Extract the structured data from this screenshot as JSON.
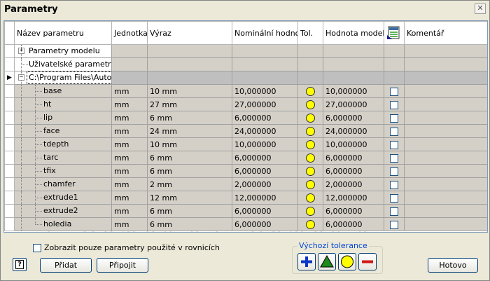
{
  "window": {
    "title": "Parametry",
    "close_label": "✕"
  },
  "columns": {
    "name": "Název parametru",
    "unit": "Jednotka",
    "expr": "Výraz",
    "nominal": "Nominální hodnota",
    "tol": "Tol.",
    "model": "Hodnota modelu",
    "export_icon": "export-parameters-icon",
    "comment": "Komentář"
  },
  "groups": {
    "model_params": "Parametry modelu",
    "user_params": "Uživatelské parametry",
    "path": "C:\\Program Files\\Auto..."
  },
  "params": [
    {
      "name": "base",
      "unit": "mm",
      "expr": "10 mm",
      "nominal": "10,000000",
      "model": "10,000000"
    },
    {
      "name": "ht",
      "unit": "mm",
      "expr": "27 mm",
      "nominal": "27,000000",
      "model": "27,000000"
    },
    {
      "name": "lip",
      "unit": "mm",
      "expr": "6 mm",
      "nominal": "6,000000",
      "model": "6,000000"
    },
    {
      "name": "face",
      "unit": "mm",
      "expr": "24 mm",
      "nominal": "24,000000",
      "model": "24,000000"
    },
    {
      "name": "tdepth",
      "unit": "mm",
      "expr": "10 mm",
      "nominal": "10,000000",
      "model": "10,000000"
    },
    {
      "name": "tarc",
      "unit": "mm",
      "expr": "6 mm",
      "nominal": "6,000000",
      "model": "6,000000"
    },
    {
      "name": "tfix",
      "unit": "mm",
      "expr": "6 mm",
      "nominal": "6,000000",
      "model": "6,000000"
    },
    {
      "name": "chamfer",
      "unit": "mm",
      "expr": "2 mm",
      "nominal": "2,000000",
      "model": "2,000000"
    },
    {
      "name": "extrude1",
      "unit": "mm",
      "expr": "12 mm",
      "nominal": "12,000000",
      "model": "12,000000"
    },
    {
      "name": "extrude2",
      "unit": "mm",
      "expr": "6 mm",
      "nominal": "6,000000",
      "model": "6,000000"
    },
    {
      "name": "holedia",
      "unit": "mm",
      "expr": "6 mm",
      "nominal": "6,000000",
      "model": "6,000000"
    }
  ],
  "footer": {
    "only_used_label": "Zobrazit pouze parametry použité v rovnicích",
    "help_label": "?",
    "add_label": "Přidat",
    "link_label": "Připojit",
    "tolerance_legend": "Výchozí tolerance",
    "done_label": "Hotovo"
  },
  "colors": {
    "tol_plus": "#0a36c8",
    "tol_upper": "#1c8a1c",
    "tol_nominal": "#ffff00",
    "tol_minus": "#d01818"
  }
}
